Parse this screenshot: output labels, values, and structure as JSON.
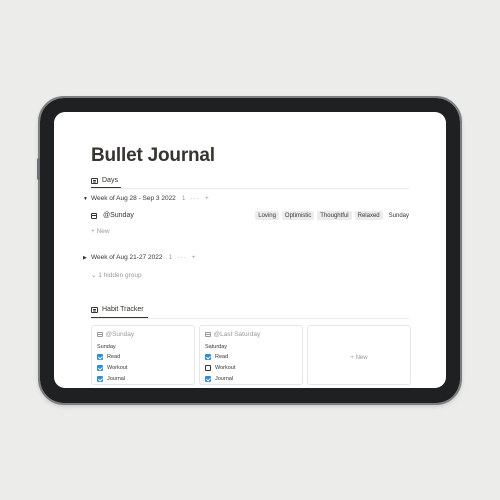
{
  "page": {
    "title": "Bullet Journal",
    "days_view_tab": "Days",
    "groups": [
      {
        "label": "Week of Aug 28 - Sep 3 2022",
        "count": "1",
        "actions": "···",
        "add": "+",
        "row": {
          "name": "@Sunday",
          "tags": [
            "Loving",
            "Optimistic",
            "Thoughtful",
            "Relaxed"
          ],
          "day": "Sunday"
        },
        "new_label": "+ New"
      },
      {
        "label": "Week of Aug 21-27 2022",
        "count": "1",
        "actions": "···",
        "add": "+"
      }
    ],
    "hidden_group": "⌄ 1 hidden group",
    "habit_tab": "Habit Tracker",
    "cards": [
      {
        "title": "@Sunday",
        "subtitle": "Sunday",
        "habits": [
          {
            "label": "Read",
            "checked": true
          },
          {
            "label": "Workout",
            "checked": true
          },
          {
            "label": "Journal",
            "checked": true
          }
        ]
      },
      {
        "title": "@Last Saturday",
        "subtitle": "Saturday",
        "habits": [
          {
            "label": "Read",
            "checked": true
          },
          {
            "label": "Workout",
            "checked": false
          },
          {
            "label": "Journal",
            "checked": true
          }
        ]
      }
    ],
    "new_card": "+ New"
  },
  "colors": {
    "background": "#ececea",
    "device": "#1e2022",
    "text": "#37352f",
    "muted": "#9b9a97",
    "tag_bg": "#ebeced",
    "checkbox": "#2e8fd6"
  }
}
